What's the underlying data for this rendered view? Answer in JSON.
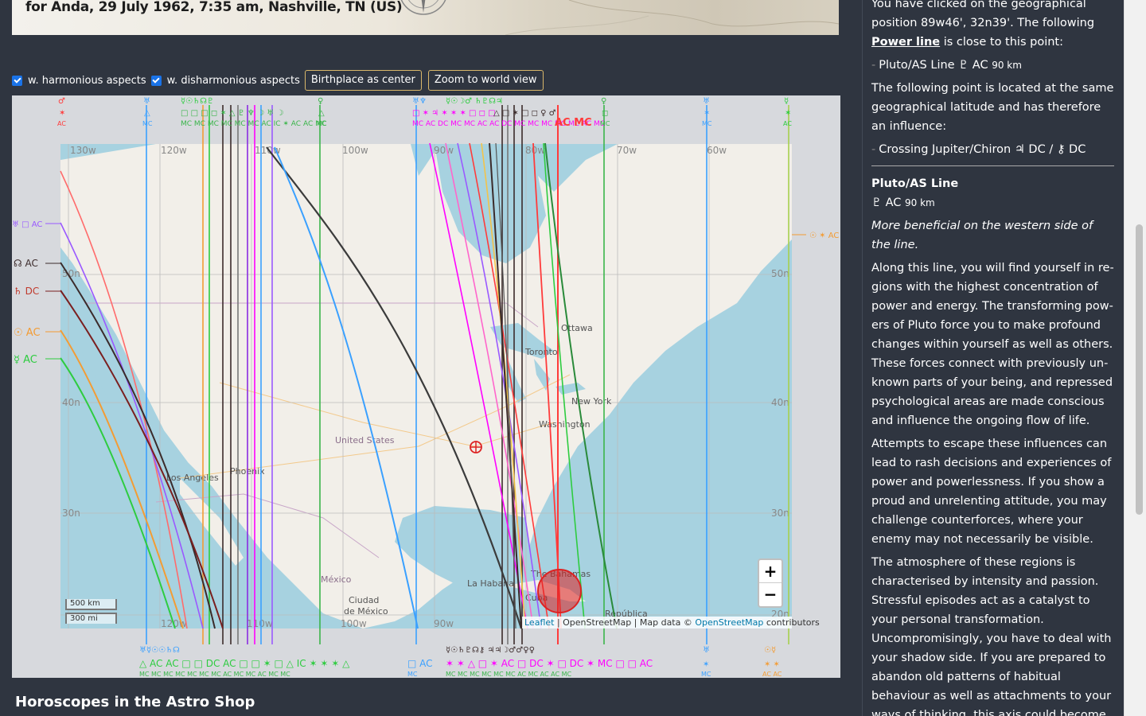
{
  "header": {
    "title": "for Anda, 29 July 1962, 7:35 am, Nashville, TN (US)"
  },
  "controls": {
    "harmonious_label": "w. harmonious aspects",
    "harmonious_checked": true,
    "disharmonious_label": "w. disharmonious aspects",
    "disharmonious_checked": true,
    "birthplace_button": "Birthplace as center",
    "world_button": "Zoom to world view"
  },
  "map": {
    "longitude_labels": [
      "130w",
      "120w",
      "110w",
      "100w",
      "90w",
      "80w",
      "70w",
      "60w"
    ],
    "latitude_labels": [
      "50n",
      "40n",
      "30n",
      "20n"
    ],
    "bottom_lon_labels": [
      "120w",
      "110w",
      "100w",
      "90w"
    ],
    "place_labels": [
      "Ottawa",
      "Toronto",
      "New York",
      "Washington",
      "United States",
      "Phoenix",
      "Los Angeles",
      "México",
      "Ciudad de México",
      "La Habana",
      "Cuba",
      "The Bahamas",
      "República"
    ],
    "left_line_labels": [
      "♅ □ AC",
      "☊ AC",
      "♄ DC",
      "☉ AC",
      "☿ AC"
    ],
    "right_line_label": "☉ ✶ AC",
    "scale_km": "500 km",
    "scale_mi": "300 mi",
    "zoom_in": "+",
    "zoom_out": "−",
    "attribution": {
      "leaflet": "Leaflet",
      "sep1": " | OpenStreetMap | Map data © ",
      "osm": "OpenStreetMap",
      "contributors": " contributors"
    },
    "line_colors": {
      "sun": "#f39c34",
      "moon": "#9a59ff",
      "mercury": "#2ecc40",
      "venus": "#3ab54a",
      "mars": "#ff3b3b",
      "jupiter": "#ff00ff",
      "saturn": "#3b2b2b",
      "uranus": "#3aa0ff",
      "neptune": "#8a2be2",
      "pluto": "#222222"
    }
  },
  "shop": {
    "title": "Horoscopes in the Astro Shop"
  },
  "sidebar": {
    "intro_1": "You have clicked on the geographical position 89w46', 32n39'. The following ",
    "intro_link": "Power line",
    "intro_2": " is close to this point:",
    "power_item": "Pluto/AS Line ♇ AC",
    "power_item_dist": "90 km",
    "same_lat": "The following point is located at the same geographical latitude and has therefore an influence:",
    "crossing_item": "Crossing Jupiter/Chiron ♃ DC / ⚷ DC",
    "section_title": "Pluto/AS Line",
    "section_symbol": "♇ AC",
    "section_dist": "90 km",
    "section_note": "More beneficial on the western side of the line.",
    "para_1": "Along this line, you will find yourself in re­gions with the highest concentration of power and energy. The transforming pow­ers of Pluto force you to make profound changes within yourself as well as others. These forces connect with previously un­known parts of your being, and repressed psychological areas are made conscious and influence the ongoing flow of life.",
    "para_2": "Attempts to escape these influences can lead to rash decisions and experiences of power and powerlessness. If you show a proud and unrelenting attitude, you may challenge counterforces, where your enemy may not necessarily be visible.",
    "para_3": "The atmosphere of these regions is charac­terised by intensity and passion. Stressful episodes act as a catalyst to your personal transformation. Uncompromisingly, you have to deal with your shadow side. If you are prepared to abandon old patterns of habitual behaviour as well as attachments to your ways of thinking, this axis could be­come the turning point of your life."
  }
}
